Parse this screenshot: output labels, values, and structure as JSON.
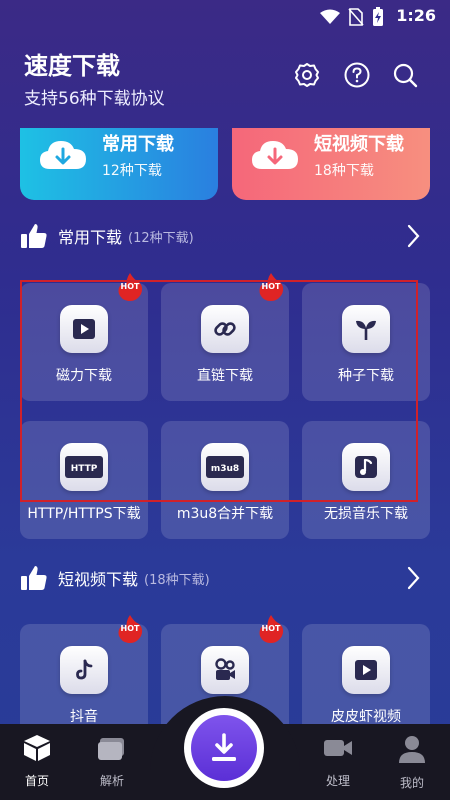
{
  "status": {
    "time": "1:26"
  },
  "header": {
    "title": "速度下载",
    "subtitle": "支持56种下载协议"
  },
  "top_cards": [
    {
      "title": "常用下载",
      "count": "12种下载",
      "color": "#1ec1e4"
    },
    {
      "title": "短视频下载",
      "count": "18种下载",
      "color": "#f5677a"
    }
  ],
  "sections": {
    "common": {
      "name": "常用下载",
      "count": "(12种下载)"
    },
    "short_video": {
      "name": "短视频下载",
      "count": "(18种下载)"
    }
  },
  "hot_badge": "HOT",
  "common_items": [
    {
      "label": "磁力下载",
      "icon": "play-icon"
    },
    {
      "label": "直链下载",
      "icon": "link-icon"
    },
    {
      "label": "种子下载",
      "icon": "sprout-icon"
    },
    {
      "label": "HTTP/HTTPS下载",
      "icon": "http-icon",
      "icon_text": "HTTP"
    },
    {
      "label": "m3u8合并下载",
      "icon": "m3u8-icon",
      "icon_text": "m3u8"
    },
    {
      "label": "无损音乐下载",
      "icon": "music-note-icon"
    }
  ],
  "video_items": [
    {
      "label": "抖音",
      "icon": "tiktok-icon"
    },
    {
      "label": "",
      "icon": "kuaishou-icon"
    },
    {
      "label": "皮皮虾视频",
      "icon": "play-icon"
    }
  ],
  "nav": [
    {
      "label": "首页",
      "icon": "cube-icon",
      "active": true
    },
    {
      "label": "解析",
      "icon": "folder-icon"
    },
    {
      "label": "处理",
      "icon": "video-camera-icon"
    },
    {
      "label": "我的",
      "icon": "user-icon"
    }
  ],
  "colors": {
    "accent": "#6a3fe0",
    "hot": "#e02424",
    "highlight_frame": "#d0212a"
  }
}
